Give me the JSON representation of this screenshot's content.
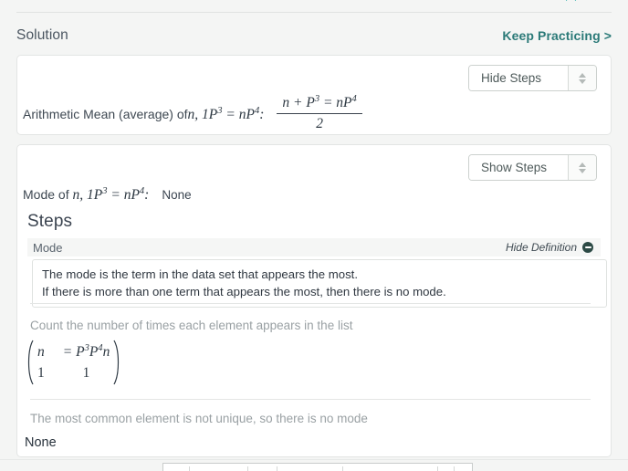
{
  "topbar": {
    "icons": [
      {
        "name": "download-icon",
        "color": "#16a8a0"
      },
      {
        "name": "bookmark-icon",
        "color": "#16a8a0"
      },
      {
        "name": "share-icon",
        "color": "#2c7a78"
      }
    ]
  },
  "header": {
    "title": "Solution",
    "keep_practicing_label": "Keep Practicing >",
    "accent_color": "#2b7a78"
  },
  "mean_card": {
    "select": {
      "value": "Hide Steps",
      "options": [
        "Hide Steps",
        "Show Steps"
      ]
    },
    "label": "Arithmetic Mean (average) of ",
    "expr_var": "n",
    "expr_comma": ", 1",
    "expr_p1": "P",
    "expr_sup1": "3",
    "expr_eq": " = ",
    "expr_n2": "n",
    "expr_p2": "P",
    "expr_sup2": "4",
    "expr_colon": ":",
    "fraction": {
      "numerator_plain": "n + P",
      "numerator_sup1": "3",
      "numerator_mid": " = nP",
      "numerator_sup2": "4",
      "denominator": "2"
    }
  },
  "mode_card": {
    "select": {
      "value": "Show Steps",
      "options": [
        "Show Steps",
        "Hide Steps"
      ]
    },
    "mode_label": "Mode of ",
    "mode_var": "n",
    "mode_comma": ", 1",
    "mode_p1": "P",
    "mode_sup1": "3",
    "mode_eq": " = ",
    "mode_n2": "n",
    "mode_p2": "P",
    "mode_sup2": "4",
    "mode_colon": ":",
    "mode_value": "None",
    "steps_heading": "Steps",
    "definition": {
      "term": "Mode",
      "toggle_label": "Hide Definition",
      "line1": "The mode is the term in the data set that appears the most.",
      "line2": "If there is more than one term that appears the most, then there is no mode."
    },
    "step_count_text": "Count the number of times each element appears in the list",
    "matrix": {
      "r1c1": "n",
      "r1c2_eq": "= P",
      "r1c2_sup1": "3",
      "r1c2_p2": "P",
      "r1c2_sup2": "4",
      "r1c2_n": "n",
      "r2c1": "1",
      "r2c2": "1"
    },
    "step_conclusion_text": "The most common element is not unique, so there is no mode",
    "final_answer": "None"
  }
}
